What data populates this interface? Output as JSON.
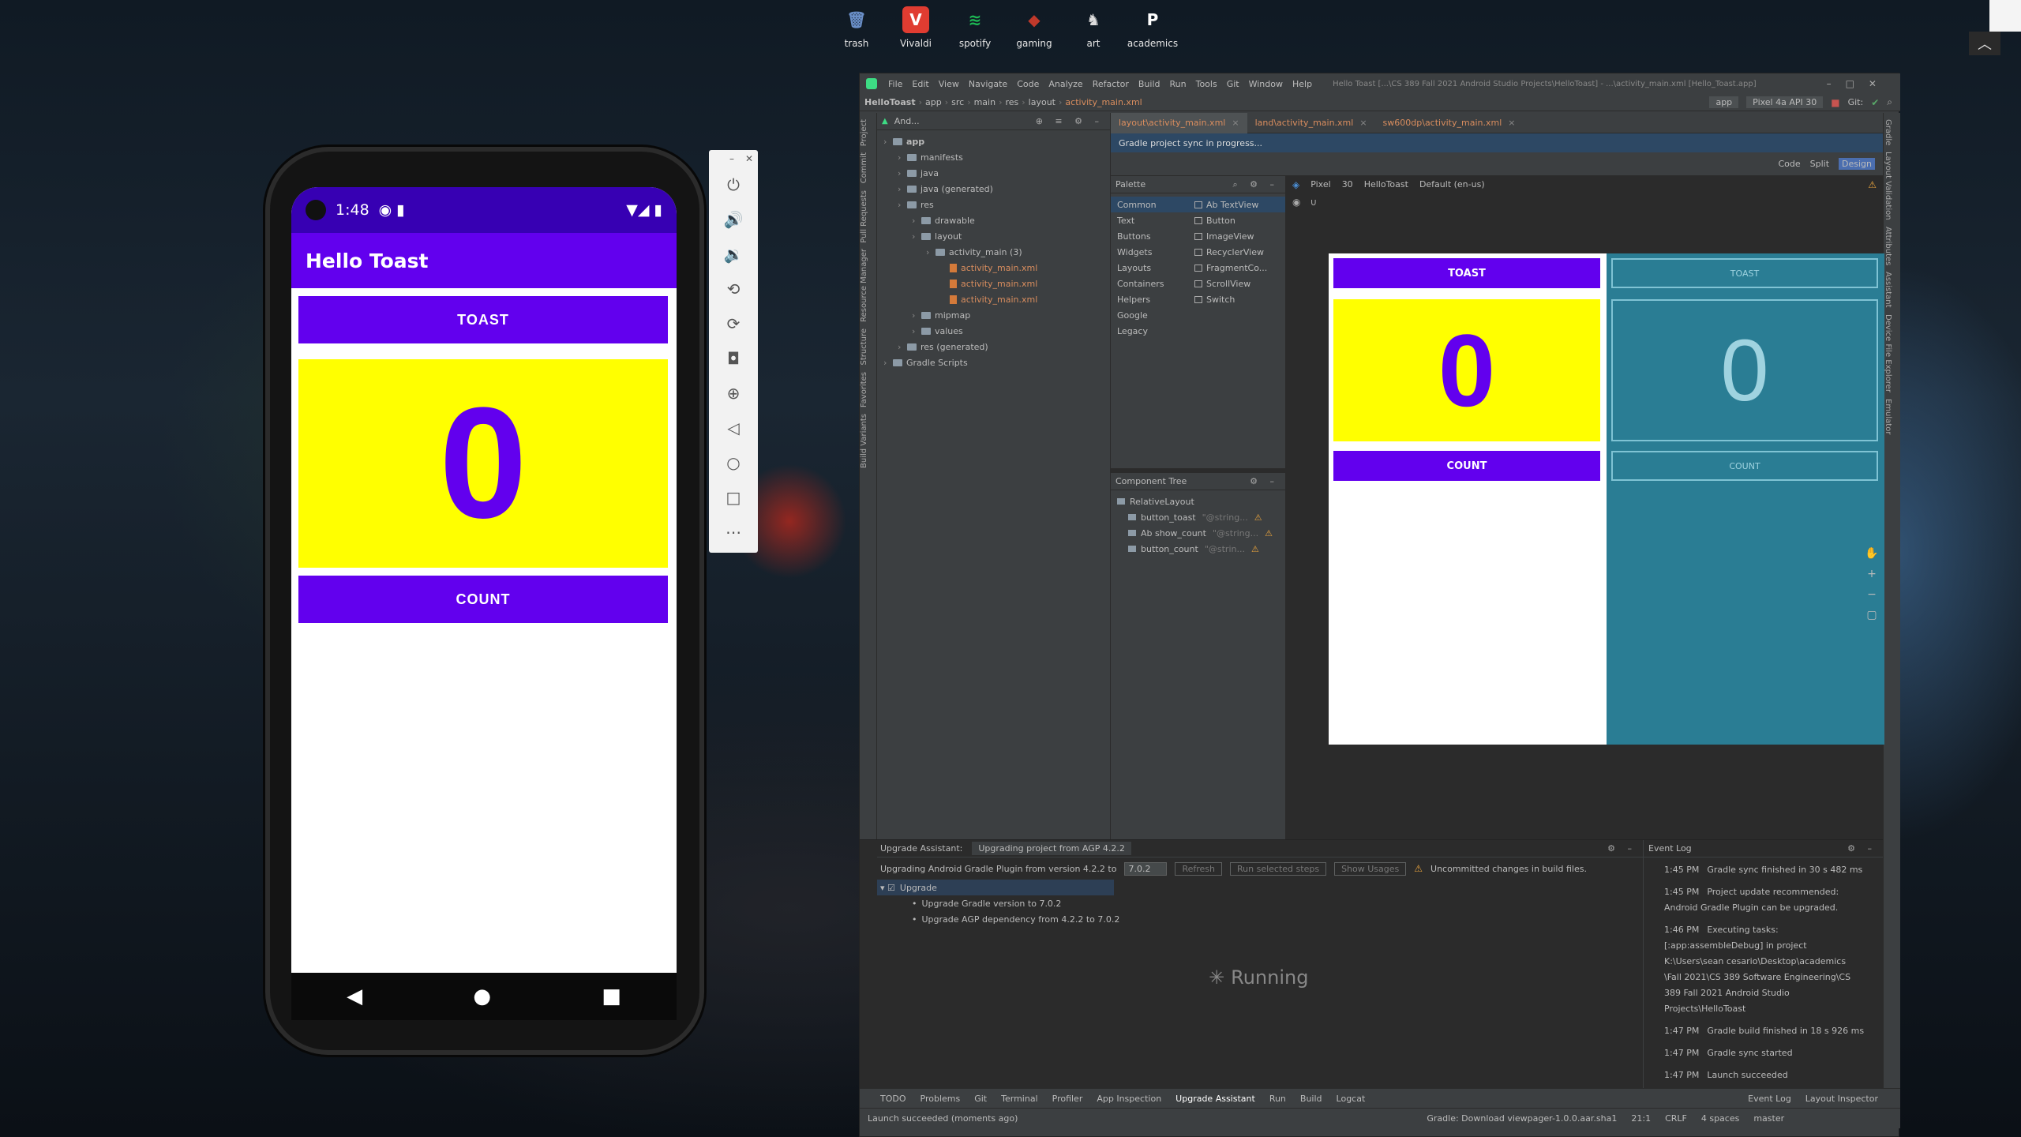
{
  "desktop": {
    "icons": [
      {
        "label": "trash",
        "icon": "trash-icon",
        "color": "#6a8fc8",
        "glyph": "🗑"
      },
      {
        "label": "Vivaldi",
        "icon": "vivaldi-icon",
        "color": "#e03c31",
        "glyph": "V"
      },
      {
        "label": "spotify",
        "icon": "spotify-icon",
        "color": "#1db954",
        "glyph": "≋"
      },
      {
        "label": "gaming",
        "icon": "gaming-icon",
        "color": "#c0392b",
        "glyph": "◆"
      },
      {
        "label": "art",
        "icon": "art-icon",
        "color": "#dddddd",
        "glyph": "♞"
      },
      {
        "label": "academics",
        "icon": "academics-icon",
        "color": "#ffffff",
        "glyph": "P"
      }
    ]
  },
  "phone": {
    "time": "1:48",
    "app_title": "Hello Toast",
    "toast_label": "TOAST",
    "count_value": "0",
    "count_label": "COUNT",
    "colors": {
      "primary": "#6200ee",
      "primary_dark": "#3700b3",
      "count_bg": "#ffff00",
      "count_text": "#6200ee"
    }
  },
  "emulator_toolbar": [
    "power-icon",
    "volume-up-icon",
    "volume-down-icon",
    "rotate-left-icon",
    "rotate-right-icon",
    "camera-icon",
    "zoom-icon",
    "back-icon",
    "home-icon",
    "overview-icon",
    "more-icon"
  ],
  "ide": {
    "menu": [
      "File",
      "Edit",
      "View",
      "Navigate",
      "Code",
      "Analyze",
      "Refactor",
      "Build",
      "Run",
      "Tools",
      "Git",
      "Window",
      "Help"
    ],
    "window_title": "Hello Toast [...\\CS 389 Fall 2021 Android Studio Projects\\HelloToast] - ...\\activity_main.xml [Hello_Toast.app]",
    "breadcrumb": [
      "HelloToast",
      "app",
      "src",
      "main",
      "res",
      "layout",
      "activity_main.xml"
    ],
    "run_config": "app",
    "device": "Pixel 4a API 30",
    "git_label": "Git:",
    "project_view": "And...",
    "tree": [
      {
        "label": "app",
        "depth": 0,
        "kind": "folder",
        "bold": true
      },
      {
        "label": "manifests",
        "depth": 1,
        "kind": "folder"
      },
      {
        "label": "java",
        "depth": 1,
        "kind": "folder"
      },
      {
        "label": "java (generated)",
        "depth": 1,
        "kind": "folder"
      },
      {
        "label": "res",
        "depth": 1,
        "kind": "folder"
      },
      {
        "label": "drawable",
        "depth": 2,
        "kind": "folder"
      },
      {
        "label": "layout",
        "depth": 2,
        "kind": "folder"
      },
      {
        "label": "activity_main (3)",
        "depth": 3,
        "kind": "folder"
      },
      {
        "label": "activity_main.xml",
        "depth": 4,
        "kind": "xml"
      },
      {
        "label": "activity_main.xml",
        "depth": 4,
        "kind": "xml"
      },
      {
        "label": "activity_main.xml",
        "depth": 4,
        "kind": "xml"
      },
      {
        "label": "mipmap",
        "depth": 2,
        "kind": "folder"
      },
      {
        "label": "values",
        "depth": 2,
        "kind": "folder"
      },
      {
        "label": "res (generated)",
        "depth": 1,
        "kind": "folder"
      },
      {
        "label": "Gradle Scripts",
        "depth": 0,
        "kind": "folder"
      }
    ],
    "tabs": [
      "layout\\activity_main.xml",
      "land\\activity_main.xml",
      "sw600dp\\activity_main.xml"
    ],
    "sync_message": "Gradle project sync in progress...",
    "view_modes": [
      "Code",
      "Split",
      "Design"
    ],
    "palette_title": "Palette",
    "palette_categories": [
      "Common",
      "Text",
      "Buttons",
      "Widgets",
      "Layouts",
      "Containers",
      "Helpers",
      "Google",
      "Legacy"
    ],
    "palette_items": [
      "Ab TextView",
      "Button",
      "ImageView",
      "RecyclerView",
      "FragmentCo...",
      "ScrollView",
      "Switch"
    ],
    "design_toolbar": {
      "device": "Pixel",
      "api": "30",
      "theme": "HelloToast",
      "locale": "Default (en-us)"
    },
    "component_tree_title": "Component Tree",
    "component_tree": [
      {
        "label": "RelativeLayout",
        "hint": ""
      },
      {
        "label": "button_toast",
        "hint": "\"@string..."
      },
      {
        "label": "Ab show_count",
        "hint": "\"@string..."
      },
      {
        "label": "button_count",
        "hint": "\"@strin..."
      }
    ],
    "preview": {
      "toast": "TOAST",
      "count": "0",
      "count_btn": "COUNT"
    },
    "upgrade": {
      "tab_label": "Upgrade Assistant:",
      "tab_title": "Upgrading project from AGP 4.2.2",
      "message": "Upgrading Android Gradle Plugin from version 4.2.2 to",
      "version": "7.0.2",
      "refresh": "Refresh",
      "run_steps": "Run selected steps",
      "show_usages": "Show Usages",
      "warning": "Uncommitted changes in build files.",
      "root": "Upgrade",
      "steps": [
        "Upgrade Gradle version to 7.0.2",
        "Upgrade AGP dependency from 4.2.2 to 7.0.2"
      ],
      "running": "Running"
    },
    "event_log": {
      "title": "Event Log",
      "entries": [
        {
          "time": "1:45 PM",
          "text": "Gradle sync finished in 30 s 482 ms"
        },
        {
          "time": "1:45 PM",
          "text": "Project update recommended:\nAndroid Gradle Plugin can be upgraded."
        },
        {
          "time": "1:46 PM",
          "text": "Executing tasks:\n[:app:assembleDebug] in project\nK:\\Users\\sean cesario\\Desktop\\academics\n\\Fall 2021\\CS 389 Software Engineering\\CS\n389 Fall 2021 Android Studio\nProjects\\HelloToast"
        },
        {
          "time": "1:47 PM",
          "text": "Gradle build finished in 18 s 926 ms"
        },
        {
          "time": "1:47 PM",
          "text": "Gradle sync started"
        },
        {
          "time": "1:47 PM",
          "text": "Launch succeeded"
        }
      ]
    },
    "bottom_tools": [
      "TODO",
      "Problems",
      "Git",
      "Terminal",
      "Profiler",
      "App Inspection",
      "Upgrade Assistant",
      "Run",
      "Build",
      "Logcat"
    ],
    "right_bottom_tools": [
      "Event Log",
      "Layout Inspector"
    ],
    "status_left": "Launch succeeded (moments ago)",
    "status_right": "Gradle: Download viewpager-1.0.0.aar.sha1",
    "status_pos": "21:1",
    "status_crlf": "CRLF",
    "status_indent": "4 spaces",
    "status_branch": "master",
    "left_tools": [
      "Project",
      "Commit",
      "Pull Requests",
      "Resource Manager",
      "Structure",
      "Favorites",
      "Build Variants"
    ],
    "right_tools": [
      "Gradle",
      "Layout Validation",
      "Attributes",
      "Assistant",
      "Device File Explorer",
      "Emulator"
    ]
  }
}
